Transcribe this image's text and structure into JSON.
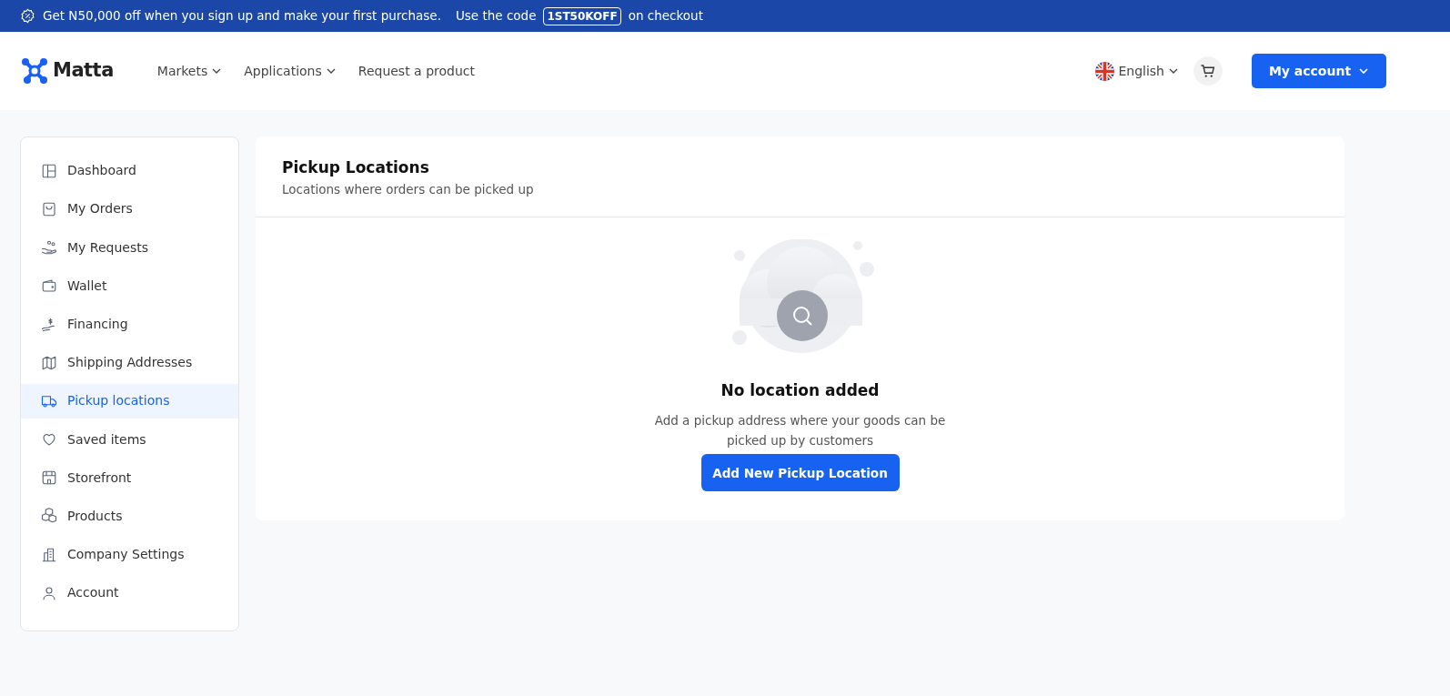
{
  "promo_banner": {
    "text": "Get N50,000 off when you sign up and make your first purchase.",
    "code_prefix": "Use the code",
    "code": "1ST50KOFF",
    "code_suffix": "on checkout"
  },
  "navbar": {
    "logo": "Matta",
    "menu": [
      {
        "label": "Markets",
        "dropdown": true
      },
      {
        "label": "Applications",
        "dropdown": true
      },
      {
        "label": "Request a product",
        "dropdown": false
      }
    ],
    "language": "English",
    "account_button": "My account"
  },
  "sidebar": {
    "items": [
      {
        "label": "Dashboard",
        "selected": false
      },
      {
        "label": "My Orders",
        "selected": false
      },
      {
        "label": "My Requests",
        "selected": false
      },
      {
        "label": "Wallet",
        "selected": false
      },
      {
        "label": "Financing",
        "selected": false
      },
      {
        "label": "Shipping Addresses",
        "selected": false
      },
      {
        "label": "Pickup locations",
        "selected": true
      },
      {
        "label": "Saved items",
        "selected": false
      },
      {
        "label": "Storefront",
        "selected": false
      },
      {
        "label": "Products",
        "selected": false
      },
      {
        "label": "Company Settings",
        "selected": false
      },
      {
        "label": "Account",
        "selected": false
      }
    ]
  },
  "panel": {
    "title": "Pickup Locations",
    "subtitle": "Locations where orders can be picked up",
    "empty_state": {
      "title": "No location added",
      "message": "Add a pickup address where your goods can be picked up by customers",
      "button": "Add New Pickup Location"
    }
  }
}
